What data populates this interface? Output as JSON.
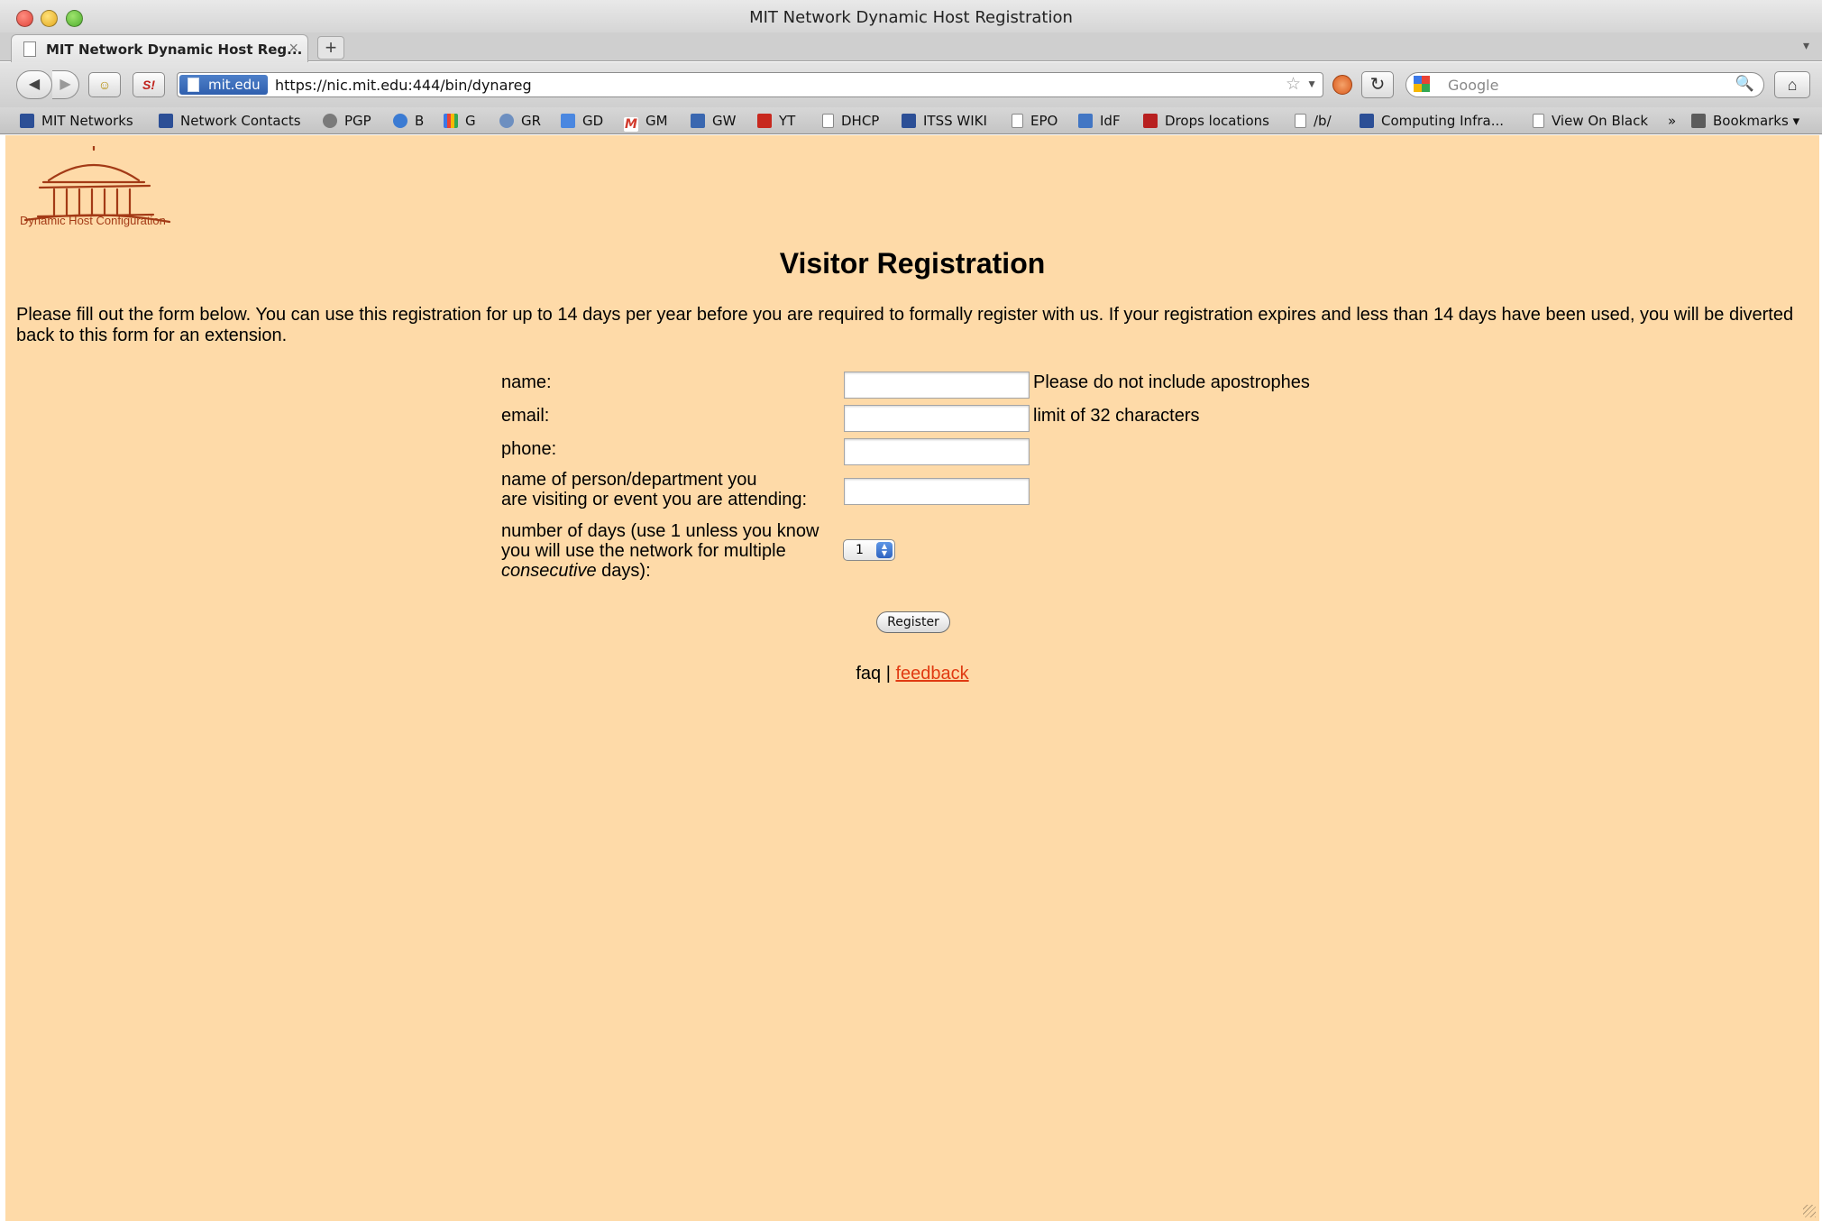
{
  "window": {
    "title": "MIT Network Dynamic Host Registration"
  },
  "tabs": [
    {
      "title": "MIT Network Dynamic Host Reg...",
      "close": "×"
    }
  ],
  "new_tab": "+",
  "tablist_arrow": "▾",
  "navbar": {
    "back": "◀",
    "forward": "▶",
    "ext1": "☺",
    "ext2": "S!",
    "site_identity": "mit.edu",
    "url": "https://nic.mit.edu:444/bin/dynareg",
    "star": "☆",
    "dropdown": "▼",
    "reload": "↻",
    "search_placeholder": "Google",
    "search_glyph": "🔍",
    "home": "⌂"
  },
  "bookmarks": {
    "items": [
      {
        "label": "MIT Networks",
        "icon": "mit-icon"
      },
      {
        "label": "Network Contacts",
        "icon": "mit-icon"
      },
      {
        "label": "PGP",
        "icon": "pgp-icon"
      },
      {
        "label": "B",
        "icon": "b-icon"
      },
      {
        "label": "G",
        "icon": "google-icon"
      },
      {
        "label": "GR",
        "icon": "reader-icon"
      },
      {
        "label": "GD",
        "icon": "docs-icon"
      },
      {
        "label": "GM",
        "icon": "gmail-icon"
      },
      {
        "label": "GW",
        "icon": "wave-icon"
      },
      {
        "label": "YT",
        "icon": "youtube-icon"
      },
      {
        "label": "DHCP",
        "icon": "page-icon"
      },
      {
        "label": "ITSS WIKI",
        "icon": "mit-icon"
      },
      {
        "label": "EPO",
        "icon": "page-icon"
      },
      {
        "label": "IdF",
        "icon": "idf-icon"
      },
      {
        "label": "Drops locations",
        "icon": "drops-icon"
      },
      {
        "label": "/b/",
        "icon": "page-icon"
      },
      {
        "label": "Computing Infra...",
        "icon": "mit-icon"
      },
      {
        "label": "View On Black",
        "icon": "page-icon"
      }
    ],
    "overflow": "»",
    "menu_label": "Bookmarks",
    "menu_arrow": "▾"
  },
  "page": {
    "logo_caption": "Dynamic Host Configuration",
    "heading": "Visitor Registration",
    "intro": "Please fill out the form below. You can use this registration for up to 14 days per year before you are required to formally register with us. If your registration expires and less than 14 days have been used, you will be diverted back to this form for an extension.",
    "form": {
      "name_label": "name:",
      "name_hint": "Please do not include apostrophes",
      "name_value": "",
      "email_label": "email:",
      "email_hint": "limit of 32 characters",
      "email_value": "",
      "phone_label": "phone:",
      "phone_value": "",
      "visiting_label_line1": "name of person/department you",
      "visiting_label_line2": "are visiting or event you are attending:",
      "visiting_value": "",
      "days_label_line1": "number of days (use 1 unless you know",
      "days_label_line2": "you will use the network for multiple",
      "days_label_italic": "consecutive",
      "days_label_end": " days):",
      "days_value": "1",
      "register_button": "Register"
    },
    "footer": {
      "faq": "faq",
      "separator": " | ",
      "feedback": "feedback"
    }
  },
  "colors": {
    "page_background": "#fedaa8",
    "link": "#e03a12",
    "logo": "#a33a16"
  }
}
